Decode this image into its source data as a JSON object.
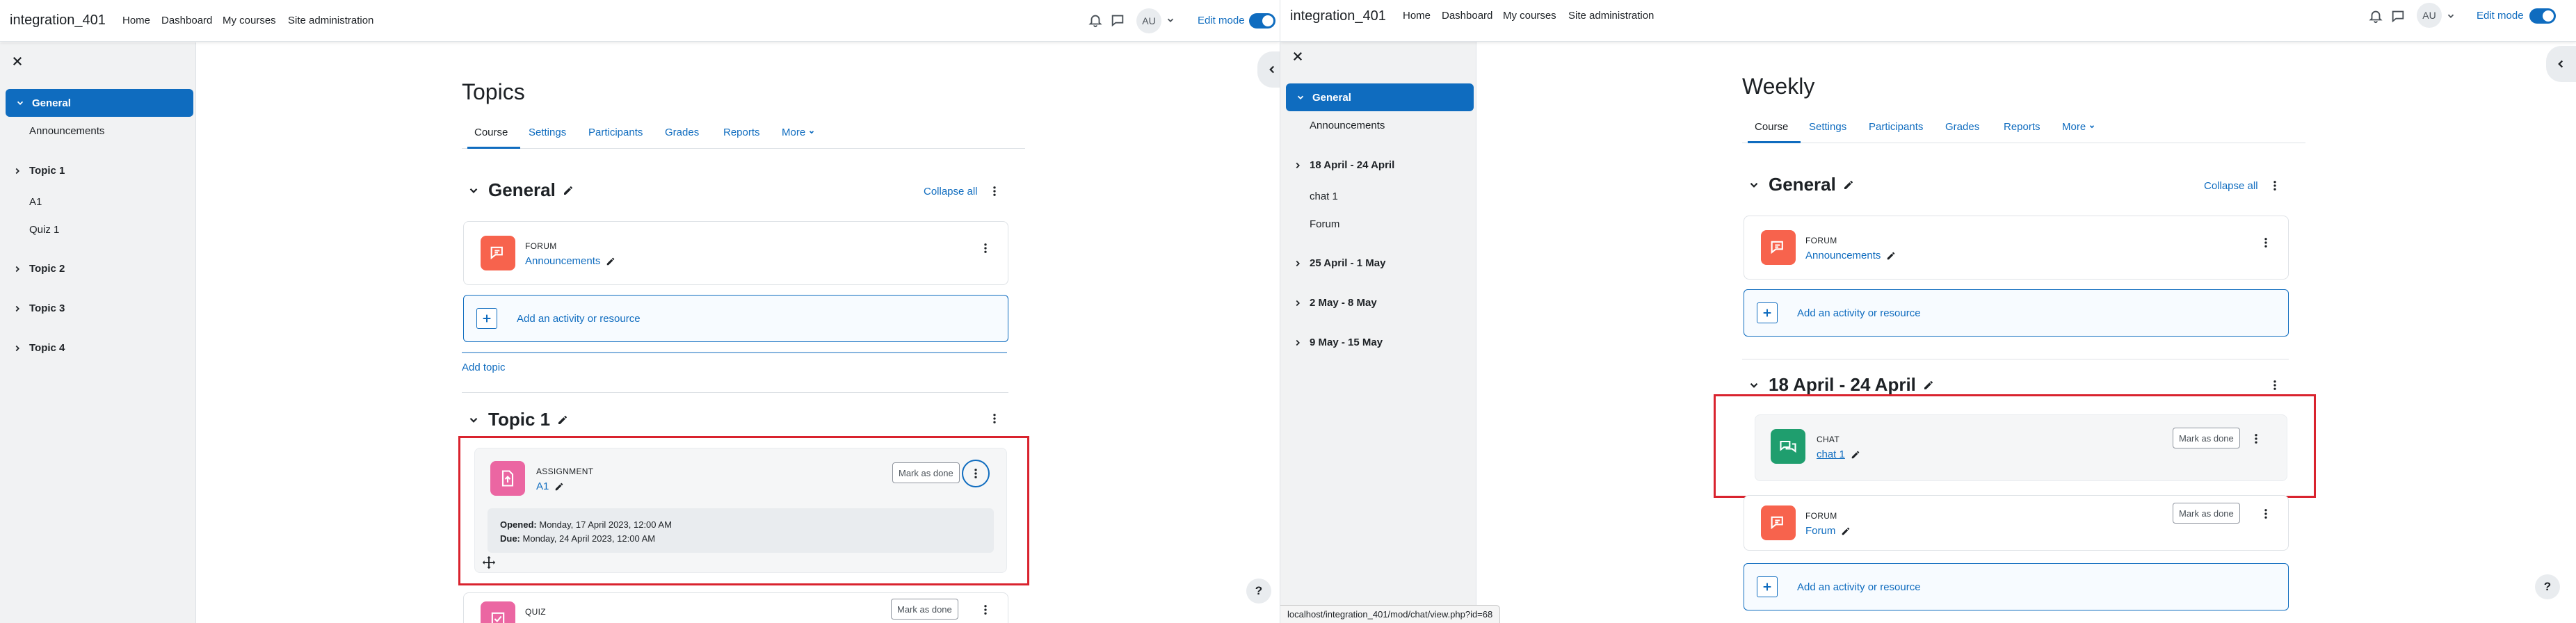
{
  "left": {
    "navbar": {
      "site_name": "integration_401",
      "links": [
        "Home",
        "Dashboard",
        "My courses",
        "Site administration"
      ],
      "avatar": "AU",
      "edit_mode_label": "Edit mode",
      "edit_mode_on": true
    },
    "drawer": {
      "active": "General",
      "items": [
        {
          "label": "Announcements",
          "kind": "activity"
        },
        {
          "label": "Topic 1",
          "kind": "section"
        },
        {
          "label": "A1",
          "kind": "activity"
        },
        {
          "label": "Quiz 1",
          "kind": "activity"
        },
        {
          "label": "Topic 2",
          "kind": "section"
        },
        {
          "label": "Topic 3",
          "kind": "section"
        },
        {
          "label": "Topic 4",
          "kind": "section"
        }
      ]
    },
    "page_title": "Topics",
    "tabs": [
      "Course",
      "Settings",
      "Participants",
      "Grades",
      "Reports",
      "More"
    ],
    "general": {
      "title": "General",
      "collapse_all": "Collapse all",
      "forum": {
        "type": "FORUM",
        "name": "Announcements"
      },
      "add_activity": "Add an activity or resource",
      "add_topic": "Add topic"
    },
    "topic1": {
      "title": "Topic 1",
      "assignment": {
        "type": "ASSIGNMENT",
        "name": "A1",
        "mark_done": "Mark as done",
        "opened_label": "Opened:",
        "opened_value": "Monday, 17 April 2023, 12:00 AM",
        "due_label": "Due:",
        "due_value": "Monday, 24 April 2023, 12:00 AM"
      },
      "quiz": {
        "type": "QUIZ",
        "mark_done": "Mark as done"
      }
    },
    "help": "?"
  },
  "right": {
    "navbar": {
      "site_name": "integration_401",
      "links": [
        "Home",
        "Dashboard",
        "My courses",
        "Site administration"
      ],
      "avatar": "AU",
      "edit_mode_label": "Edit mode",
      "edit_mode_on": true
    },
    "drawer": {
      "active": "General",
      "items": [
        {
          "label": "Announcements",
          "kind": "activity"
        },
        {
          "label": "18 April - 24 April",
          "kind": "section"
        },
        {
          "label": "chat 1",
          "kind": "activity"
        },
        {
          "label": "Forum",
          "kind": "activity"
        },
        {
          "label": "25 April - 1 May",
          "kind": "section"
        },
        {
          "label": "2 May - 8 May",
          "kind": "section"
        },
        {
          "label": "9 May - 15 May",
          "kind": "section"
        }
      ]
    },
    "page_title": "Weekly",
    "tabs": [
      "Course",
      "Settings",
      "Participants",
      "Grades",
      "Reports",
      "More"
    ],
    "general": {
      "title": "General",
      "collapse_all": "Collapse all",
      "forum": {
        "type": "FORUM",
        "name": "Announcements"
      },
      "add_activity": "Add an activity or resource"
    },
    "week1": {
      "title": "18 April - 24 April",
      "chat": {
        "type": "CHAT",
        "name": "chat 1",
        "mark_done": "Mark as done"
      },
      "forum": {
        "type": "FORUM",
        "name": "Forum",
        "mark_done": "Mark as done"
      },
      "add_activity": "Add an activity or resource"
    },
    "status_url": "localhost/integration_401/mod/chat/view.php?id=68",
    "help": "?"
  },
  "colors": {
    "primary": "#0f6cbf",
    "forum_icon": "#f7634d",
    "assignment_icon": "#eb66a2",
    "chat_icon": "#399be2",
    "chat_icon_green": "#1f9e6e",
    "highlight": "#d9232e"
  }
}
